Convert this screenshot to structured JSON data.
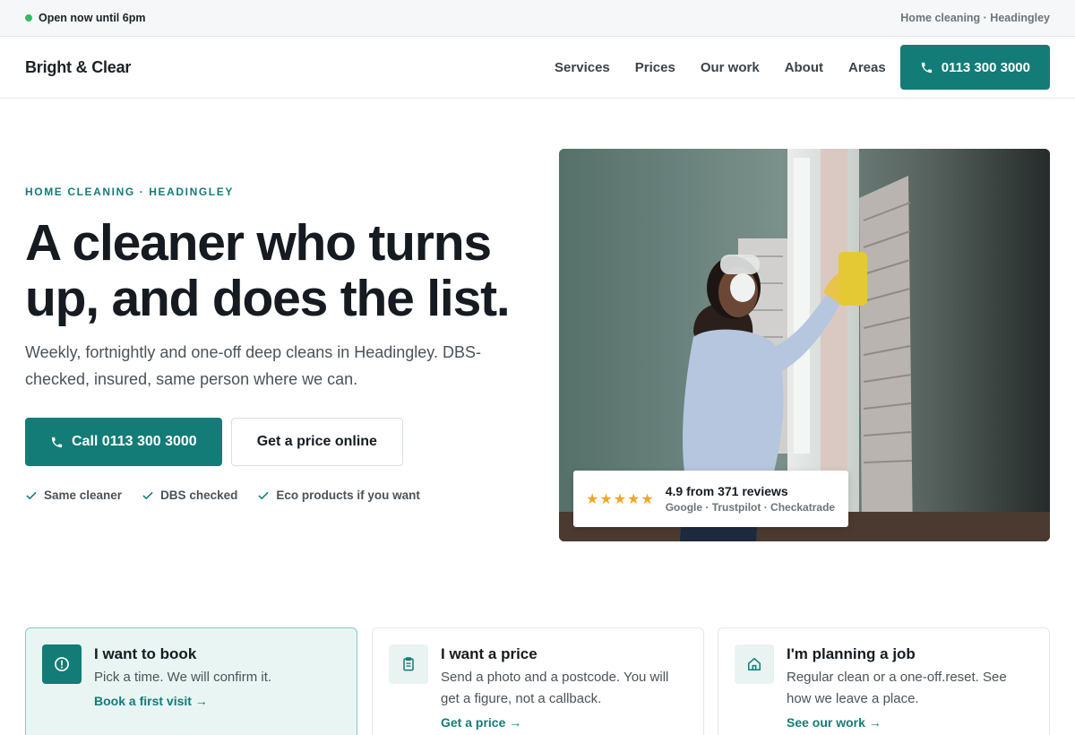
{
  "topbar": {
    "open_text": "Open now until 6pm",
    "right_text": "Home cleaning · Headingley"
  },
  "header": {
    "brand": "Bright & Clear",
    "nav": [
      "Services",
      "Prices",
      "Our work",
      "About",
      "Areas"
    ],
    "call_label": "0113 300 3000"
  },
  "hero": {
    "eyebrow": "HOME CLEANING · HEADINGLEY",
    "title": "A cleaner who turns up, and does the list.",
    "subtitle": "Weekly, fortnightly and one-off deep cleans in Headingley. DBS-checked, insured, same person where we can.",
    "primary_cta": "Call 0113 300 3000",
    "secondary_cta": "Get a price online",
    "checks": [
      "Same cleaner",
      "DBS checked",
      "Eco products if you want"
    ]
  },
  "review": {
    "stars": "★★★★★",
    "score": "4.9 from 371 reviews",
    "sources": "Google · Trustpilot · Checkatrade"
  },
  "cards": [
    {
      "title": "I want to book",
      "body": "Pick a time. We will confirm it.",
      "link": "Book a first visit →",
      "icon": "alert-circle-icon"
    },
    {
      "title": "I want a price",
      "body": "Send a photo and a postcode. You will get a figure, not a callback.",
      "link": "Get a price →",
      "icon": "clipboard-icon"
    },
    {
      "title": "I'm planning a job",
      "body": "Regular clean or a one-off.reset. See how we leave a place.",
      "link": "See our work →",
      "icon": "home-icon"
    }
  ],
  "colors": {
    "accent": "#137c76",
    "open_dot": "#2fbf63",
    "star": "#f2a623"
  }
}
